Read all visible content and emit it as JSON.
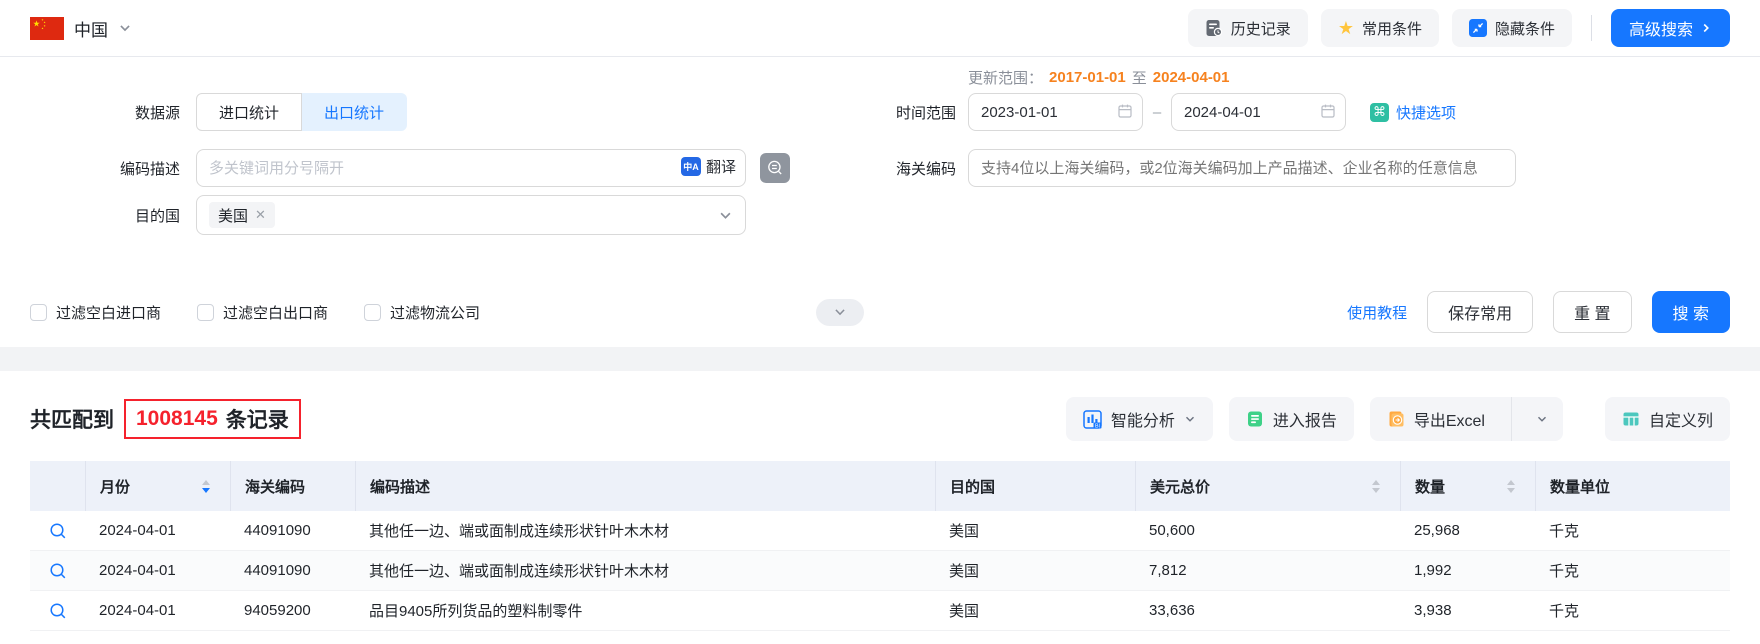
{
  "topbar": {
    "country": "中国",
    "buttons": {
      "history": "历史记录",
      "favorites": "常用条件",
      "hide": "隐藏条件",
      "advanced": "高级搜索"
    }
  },
  "form": {
    "datasource_label": "数据源",
    "tabs": {
      "import": "进口统计",
      "export": "出口统计"
    },
    "update_range": {
      "label": "更新范围：",
      "from": "2017-01-01",
      "to_word": "至",
      "to": "2024-04-01"
    },
    "time_range": {
      "label": "时间范围",
      "from": "2023-01-01",
      "dash": "–",
      "to": "2024-04-01",
      "quick": "快捷选项"
    },
    "code_desc": {
      "label": "编码描述",
      "placeholder": "多关键词用分号隔开",
      "translate": "翻译"
    },
    "hs_code": {
      "label": "海关编码",
      "placeholder": "支持4位以上海关编码，或2位海关编码加上产品描述、企业名称的任意信息"
    },
    "destination": {
      "label": "目的国",
      "tag": "美国"
    },
    "filters": [
      {
        "label": "过滤空白进口商"
      },
      {
        "label": "过滤空白出口商"
      },
      {
        "label": "过滤物流公司"
      }
    ],
    "tutorial": "使用教程",
    "save": "保存常用",
    "reset": "重 置",
    "search": "搜 索"
  },
  "results": {
    "prefix": "共匹配到",
    "count": "1008145",
    "suffix": "条记录",
    "actions": {
      "analysis": "智能分析",
      "report": "进入报告",
      "export": "导出Excel",
      "columns": "自定义列"
    }
  },
  "table": {
    "headers": [
      "月份",
      "海关编码",
      "编码描述",
      "目的国",
      "美元总价",
      "数量",
      "数量单位"
    ],
    "rows": [
      {
        "month": "2024-04-01",
        "code": "44091090",
        "desc": "其他任一边、端或面制成连续形状针叶木木材",
        "dest": "美国",
        "usd": "50,600",
        "qty": "25,968",
        "unit": "千克"
      },
      {
        "month": "2024-04-01",
        "code": "44091090",
        "desc": "其他任一边、端或面制成连续形状针叶木木材",
        "dest": "美国",
        "usd": "7,812",
        "qty": "1,992",
        "unit": "千克"
      },
      {
        "month": "2024-04-01",
        "code": "94059200",
        "desc": "品目9405所列货品的塑料制零件",
        "dest": "美国",
        "usd": "33,636",
        "qty": "3,938",
        "unit": "千克"
      }
    ]
  }
}
